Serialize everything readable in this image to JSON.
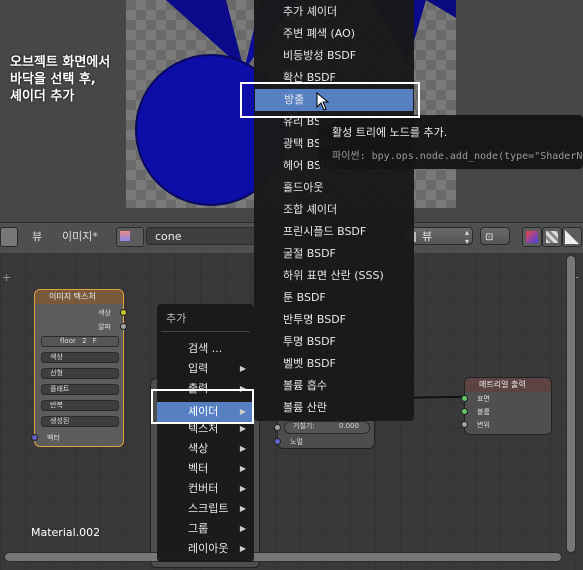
{
  "viewport": {
    "note": "오브젝트 화면에서\n바닥을 선택 후,\n셰이더 추가"
  },
  "header": {
    "view_menu": "뷰",
    "image_menu": "이미지*",
    "image_name": "cone",
    "right_view_menu": "뷰"
  },
  "nodes": {
    "image_texture": {
      "title": "이미지 텍스처",
      "out_color": "색상",
      "out_alpha": "알파",
      "image_field": "floor",
      "users": "2",
      "fake": "F",
      "selects": [
        "색상",
        "선형",
        "플래트",
        "반복",
        "생성된"
      ],
      "vector": "벡터"
    },
    "middle": {
      "roughness_label": "거칠기:",
      "roughness_value": "0.000",
      "normal": "노멀"
    },
    "material_output": {
      "title": "매트리얼 출력",
      "surface": "표면",
      "volume": "볼륨",
      "displacement": "변위"
    },
    "material_name": "Material.002"
  },
  "add_menu": {
    "title": "추가",
    "items": [
      {
        "label": "검색 ...",
        "submenu": false
      },
      {
        "label": "입력",
        "submenu": true
      },
      {
        "label": "출력",
        "submenu": true
      },
      {
        "label": "셰이더",
        "submenu": true
      },
      {
        "label": "텍스처",
        "submenu": true
      },
      {
        "label": "색상",
        "submenu": true
      },
      {
        "label": "벡터",
        "submenu": true
      },
      {
        "label": "컨버터",
        "submenu": true
      },
      {
        "label": "스크립트",
        "submenu": true
      },
      {
        "label": "그룹",
        "submenu": true
      },
      {
        "label": "레이아웃",
        "submenu": true
      }
    ]
  },
  "shader_menu": {
    "items": [
      "추가 셰이더",
      "주변 폐색 (AO)",
      "비등방성 BSDF",
      "확산 BSDF",
      "방출",
      "유리 BSDF",
      "광택 BSDF",
      "헤어 BSDF",
      "홀드아웃",
      "조합 셰이더",
      "프린시플드 BSDF",
      "굴절 BSDF",
      "하위 표면 산란 (SSS)",
      "툰 BSDF",
      "반투명 BSDF",
      "투명 BSDF",
      "벨벳 BSDF",
      "볼륨 흡수",
      "볼륨 산란"
    ],
    "highlighted": "방출"
  },
  "tooltip": {
    "title": "활성 트리에 노드를 추가.",
    "python": "파이썬: bpy.ops.node.add_node(type=\"ShaderN"
  },
  "colors": {
    "sphere": "#0d0da8",
    "highlight": "#5680c2",
    "node_frame": "#e0a040"
  }
}
